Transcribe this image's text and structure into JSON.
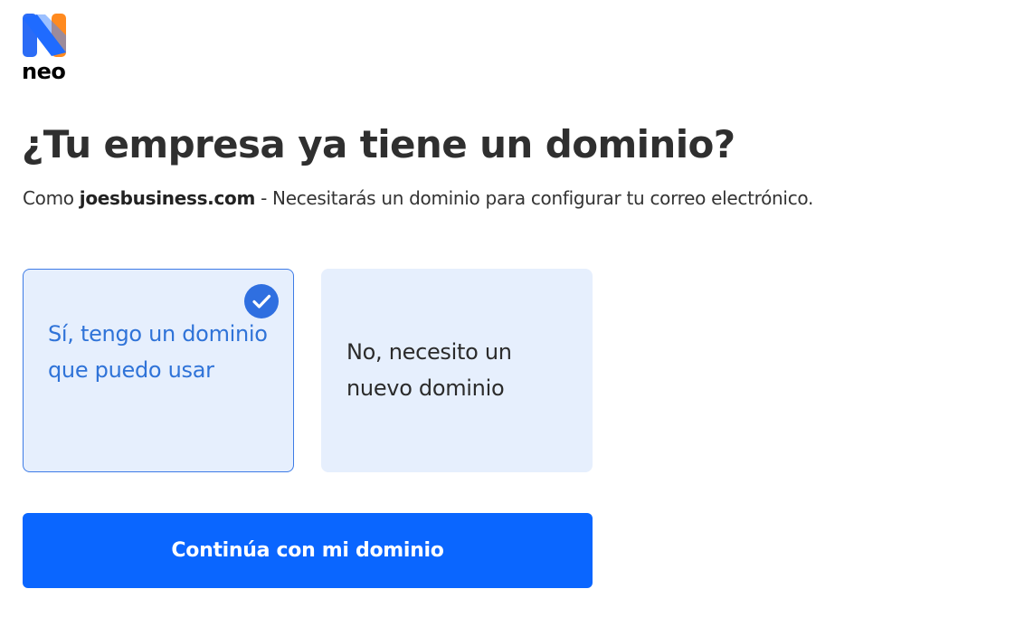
{
  "brand": {
    "name": "neo",
    "logo_icon": "neo-logo-icon",
    "colors": {
      "blue": "#1f6bff",
      "orange": "#ff8a1f"
    }
  },
  "page": {
    "title": "¿Tu empresa ya tiene un dominio?",
    "subtitle_prefix": "Como ",
    "subtitle_domain": "joesbusiness.com",
    "subtitle_suffix": " - Necesitarás un dominio para configurar tu correo electrónico."
  },
  "options": [
    {
      "label": "Sí, tengo un dominio que puedo usar",
      "selected": true
    },
    {
      "label": "No, necesito un nuevo dominio",
      "selected": false
    }
  ],
  "primary_button": {
    "label": "Continúa con mi dominio"
  },
  "colors": {
    "accent": "#0a66ff",
    "selected_border": "#3d7be6",
    "selected_text": "#2f73d8",
    "card_background": "#e6effd",
    "check_badge": "#2f6fe0"
  }
}
